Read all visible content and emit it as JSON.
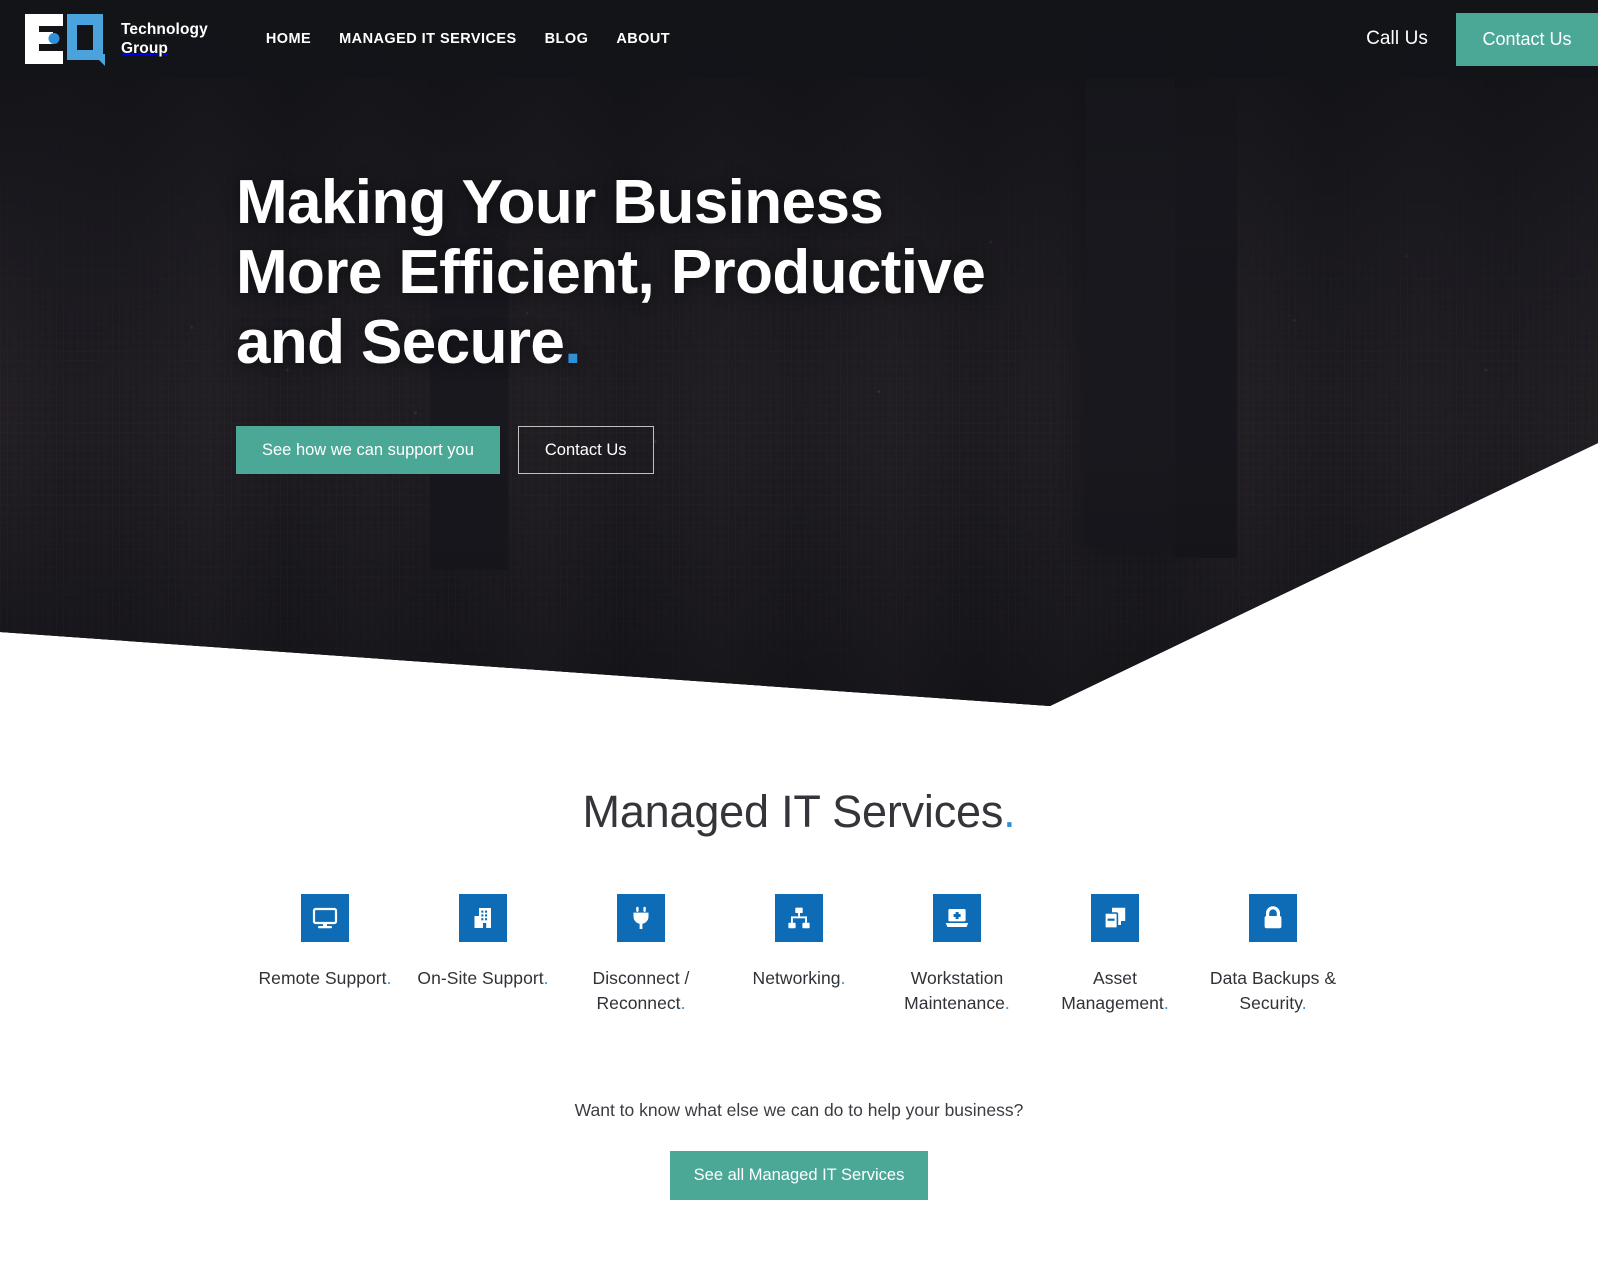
{
  "colors": {
    "teal": "#4ba796",
    "blue": "#0d6cb5",
    "accent_dot_blue": "#2f8fd8",
    "header_bg": "#141519",
    "body_text": "#2f3237"
  },
  "header": {
    "logo": {
      "mark_alt": "EQ",
      "name_line1": "Technology",
      "name_line2": "Group"
    },
    "nav": [
      {
        "label": "HOME"
      },
      {
        "label": "MANAGED IT SERVICES"
      },
      {
        "label": "BLOG"
      },
      {
        "label": "ABOUT"
      }
    ],
    "call_us_label": "Call Us",
    "contact_button_label": "Contact Us"
  },
  "hero": {
    "title_line1": "Making Your Business",
    "title_line2": "More Efficient, Productive",
    "title_line3": "and Secure",
    "title_dot": ".",
    "primary_button_label": "See how we can support you",
    "secondary_button_label": "Contact Us"
  },
  "services_section": {
    "title": "Managed IT Services",
    "title_dot": ".",
    "items": [
      {
        "icon": "desktop-monitor-icon",
        "label_line1": "Remote Support",
        "label_line2": "",
        "dot": "."
      },
      {
        "icon": "office-building-icon",
        "label_line1": "On-Site Support",
        "label_line2": "",
        "dot": "."
      },
      {
        "icon": "power-plug-icon",
        "label_line1": "Disconnect /",
        "label_line2": "Reconnect",
        "dot": "."
      },
      {
        "icon": "network-sitemap-icon",
        "label_line1": "Networking",
        "label_line2": "",
        "dot": "."
      },
      {
        "icon": "laptop-medical-icon",
        "label_line1": "Workstation",
        "label_line2": "Maintenance",
        "dot": "."
      },
      {
        "icon": "copy-documents-icon",
        "label_line1": "Asset",
        "label_line2": "Management",
        "dot": "."
      },
      {
        "icon": "lock-icon",
        "label_line1": "Data Backups &",
        "label_line2": "Security",
        "dot": "."
      }
    ],
    "cta_question": "Want to know what else we can do to help your business?",
    "cta_button_label": "See all Managed IT Services"
  }
}
